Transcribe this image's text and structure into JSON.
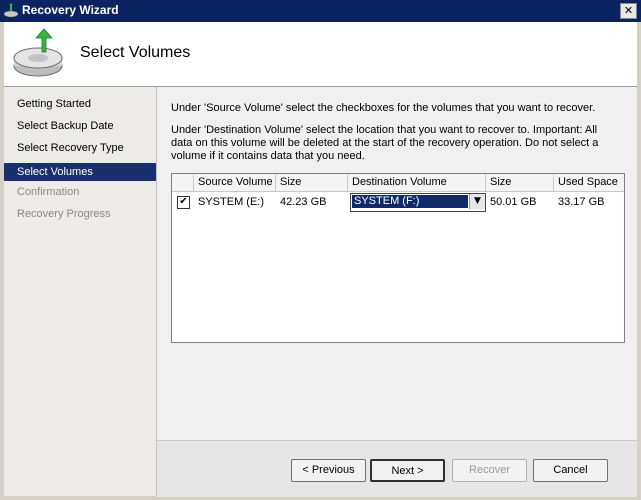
{
  "window": {
    "title": "Recovery Wizard",
    "close_label": "✕"
  },
  "header": {
    "title": "Select Volumes"
  },
  "sidebar": {
    "items": [
      {
        "label": "Getting Started",
        "state": "normal"
      },
      {
        "label": "Select Backup Date",
        "state": "normal"
      },
      {
        "label": "Select Recovery Type",
        "state": "normal"
      },
      {
        "label": "Select Volumes",
        "state": "active"
      },
      {
        "label": "Confirmation",
        "state": "disabled"
      },
      {
        "label": "Recovery Progress",
        "state": "disabled"
      }
    ]
  },
  "main": {
    "instruction1": "Under 'Source Volume' select the checkboxes for the volumes that you want to recover.",
    "instruction2": "Under 'Destination Volume' select the location that you want to recover to. Important: All data on this volume will be deleted at the start of the recovery operation. Do not select a volume if it contains data that you need.",
    "table": {
      "headers": [
        "Source Volume",
        "Size",
        "Destination Volume",
        "Size",
        "Used Space"
      ],
      "rows": [
        {
          "checked": true,
          "source": "SYSTEM (E:)",
          "source_size": "42.23 GB",
          "destination": "SYSTEM (F:)",
          "dest_size": "50.01 GB",
          "used_space": "33.17 GB"
        }
      ]
    }
  },
  "footer": {
    "previous": "< Previous",
    "next": "Next >",
    "recover": "Recover",
    "cancel": "Cancel"
  },
  "icons": {
    "title_icon": "recovery-wizard-icon",
    "header_icon": "disk-recovery-icon",
    "dropdown_arrow": "▼",
    "check_mark": "✔"
  },
  "colors": {
    "title_bar": "#0b2461",
    "active_item": "#1a2f6e",
    "selection": "#102a6b"
  }
}
